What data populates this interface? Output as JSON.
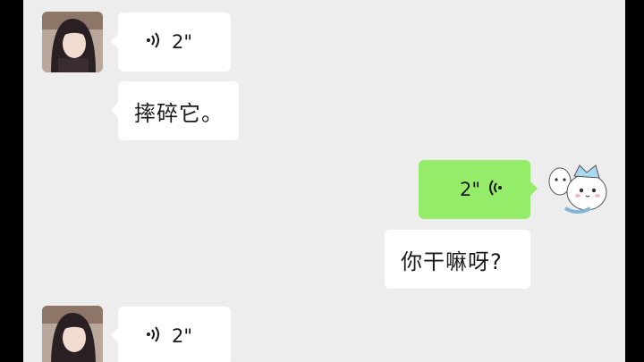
{
  "messages": [
    {
      "type": "voice",
      "side": "left",
      "duration": "2\""
    },
    {
      "type": "text",
      "side": "left",
      "text": "摔碎它。"
    },
    {
      "type": "voice",
      "side": "right",
      "duration": "2\""
    },
    {
      "type": "text",
      "side": "right",
      "text": "你干嘛呀?"
    },
    {
      "type": "voice",
      "side": "left",
      "duration": "2\""
    }
  ],
  "colors": {
    "background": "#ededed",
    "incoming_bubble": "#ffffff",
    "outgoing_bubble": "#95ec69"
  },
  "icons": [
    "voice-wave-icon",
    "avatar-anime-girl",
    "avatar-white-cat"
  ]
}
